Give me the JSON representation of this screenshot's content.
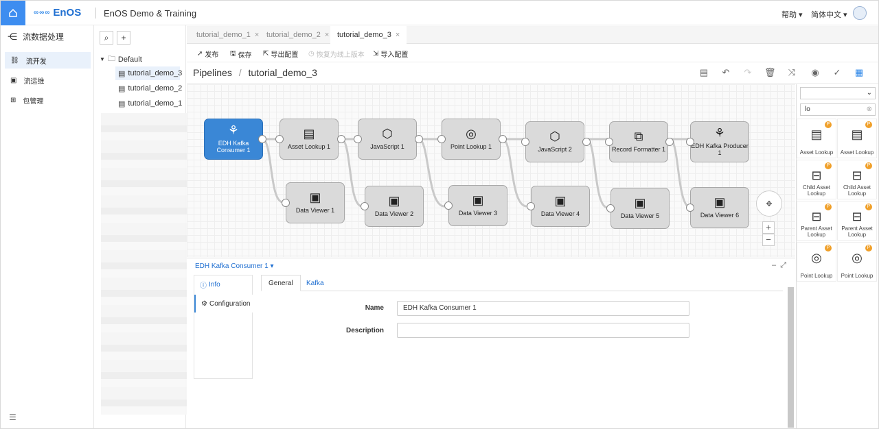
{
  "topbar": {
    "logo_text": "EnOS",
    "logo_mark": "∞∞∞",
    "app_title": "EnOS Demo & Training",
    "help": "帮助 ▾",
    "language": "简体中文 ▾"
  },
  "leftnav": {
    "title": "流数据处理",
    "items": [
      {
        "label": "流开发",
        "icon": "stream-icon",
        "active": true
      },
      {
        "label": "流运维",
        "icon": "ops-icon",
        "active": false
      },
      {
        "label": "包管理",
        "icon": "package-icon",
        "active": false
      }
    ]
  },
  "tree": {
    "root": "Default",
    "items": [
      {
        "label": "tutorial_demo_3",
        "active": true
      },
      {
        "label": "tutorial_demo_2",
        "active": false
      },
      {
        "label": "tutorial_demo_1",
        "active": false
      }
    ]
  },
  "tabs": [
    {
      "label": "tutorial_demo_1",
      "active": false
    },
    {
      "label": "tutorial_demo_2",
      "active": false
    },
    {
      "label": "tutorial_demo_3",
      "active": true
    }
  ],
  "toolbar": {
    "publish": "发布",
    "save": "保存",
    "export": "导出配置",
    "restore": "恢复为线上版本",
    "import": "导入配置"
  },
  "breadcrumb": {
    "root": "Pipelines",
    "separator": "/",
    "current": "tutorial_demo_3"
  },
  "nodes": {
    "n1": "EDH Kafka Consumer 1",
    "n2": "Asset Lookup 1",
    "n3": "JavaScript 1",
    "n4": "Point Lookup 1",
    "n5": "JavaScript 2",
    "n6": "Record Formatter 1",
    "n7": "EDH Kafka Producer 1",
    "v1": "Data Viewer 1",
    "v2": "Data Viewer 2",
    "v3": "Data Viewer 3",
    "v4": "Data Viewer 4",
    "v5": "Data Viewer 5",
    "v6": "Data Viewer 6"
  },
  "palette": {
    "select_value": "",
    "search_value": "lo",
    "items": [
      "Asset Lookup",
      "Asset Lookup",
      "Child Asset Lookup",
      "Child Asset Lookup",
      "Parent Asset Lookup",
      "Parent Asset Lookup",
      "Point Lookup",
      "Point Lookup"
    ],
    "badge": "P"
  },
  "config": {
    "title": "EDH Kafka Consumer 1 ▾",
    "left_tabs": {
      "info": "Info",
      "configuration": "Configuration"
    },
    "form_tabs": {
      "general": "General",
      "kafka": "Kafka"
    },
    "name_label": "Name",
    "name_value": "EDH Kafka Consumer 1",
    "description_label": "Description",
    "description_value": ""
  },
  "colors": {
    "accent": "#3a87d6",
    "home": "#3d8df0",
    "badge": "#f0a02a"
  }
}
